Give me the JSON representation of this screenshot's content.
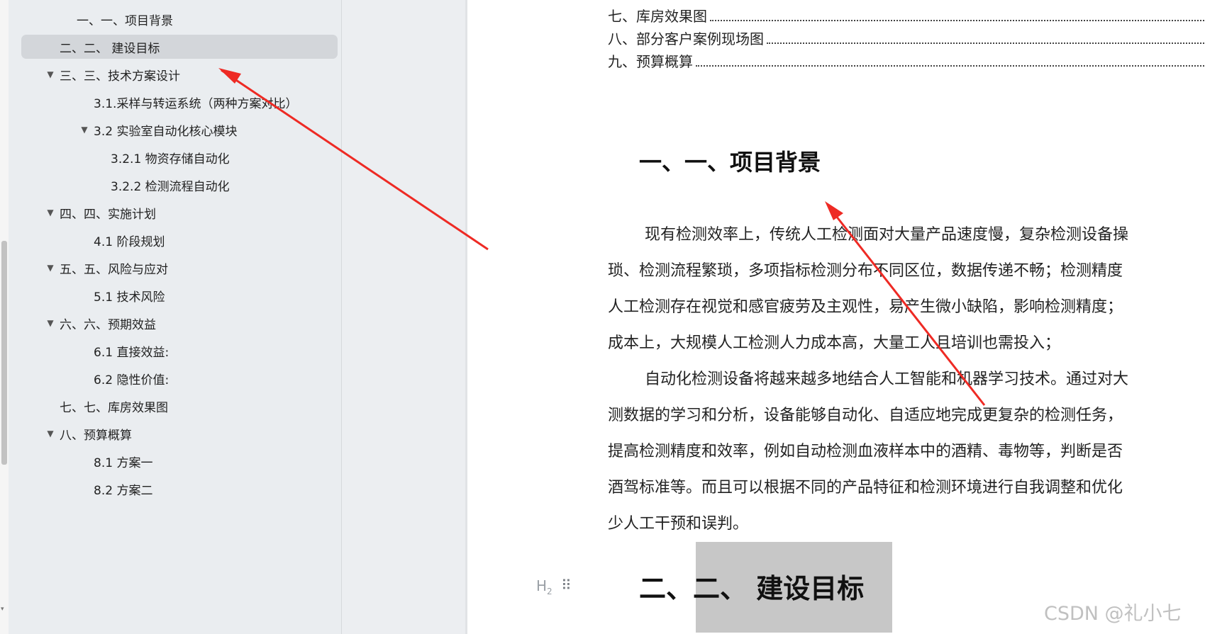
{
  "outline": {
    "items": [
      {
        "label": "一、一、项目背景",
        "toggle": ""
      },
      {
        "label": "二、二、 建设目标",
        "toggle": ""
      },
      {
        "label": "三、三、技术方案设计",
        "toggle": "▼"
      },
      {
        "label": "3.1.采样与转运系统（两种方案对比）",
        "toggle": ""
      },
      {
        "label": "3.2 实验室自动化核心模块",
        "toggle": "▼"
      },
      {
        "label": "3.2.1 物资存储自动化",
        "toggle": ""
      },
      {
        "label": "3.2.2 检测流程自动化",
        "toggle": ""
      },
      {
        "label": "四、四、实施计划",
        "toggle": "▼"
      },
      {
        "label": "4.1 阶段规划",
        "toggle": ""
      },
      {
        "label": "五、五、风险与应对",
        "toggle": "▼"
      },
      {
        "label": "5.1 技术风险",
        "toggle": ""
      },
      {
        "label": "六、六、预期效益",
        "toggle": "▼"
      },
      {
        "label": "6.1 直接效益:",
        "toggle": ""
      },
      {
        "label": "6.2 隐性价值:",
        "toggle": ""
      },
      {
        "label": "七、七、库房效果图",
        "toggle": ""
      },
      {
        "label": "八、预算概算",
        "toggle": "▼"
      },
      {
        "label": "8.1 方案一",
        "toggle": ""
      },
      {
        "label": "8.2 方案二",
        "toggle": ""
      }
    ]
  },
  "document": {
    "toc_lines": [
      "七、库房效果图",
      "八、部分客户案例现场图",
      "九、预算概算"
    ],
    "heading1": "一、一、项目背景",
    "paragraph_lines": [
      "现有检测效率上，传统人工检测面对大量产品速度慢，复杂检测设备操",
      "琐、检测流程繁琐，多项指标检测分布不同区位，数据传递不畅；检测精度",
      "人工检测存在视觉和感官疲劳及主观性，易产生微小缺陷，影响检测精度；",
      "成本上，大规模人工检测人力成本高，大量工人且培训也需投入；",
      "自动化检测设备将越来越多地结合人工智能和机器学习技术。通过对大",
      "测数据的学习和分析，设备能够自动化、自适应地完成更复杂的检测任务，",
      "提高检测精度和效率，例如自动检测血液样本中的酒精、毒物等，判断是否",
      "酒驾标准等。而且可以根据不同的产品特征和检测环境进行自我调整和优化",
      "少人工干预和误判。"
    ],
    "heading2": "二、二、  建设目标",
    "heading_badge": "H",
    "heading_badge_sub": "2",
    "drag_handle_icon": "⠿",
    "watermark": "CSDN @礼小七"
  },
  "annotation": {
    "arrow_color": "#ee2a24"
  }
}
